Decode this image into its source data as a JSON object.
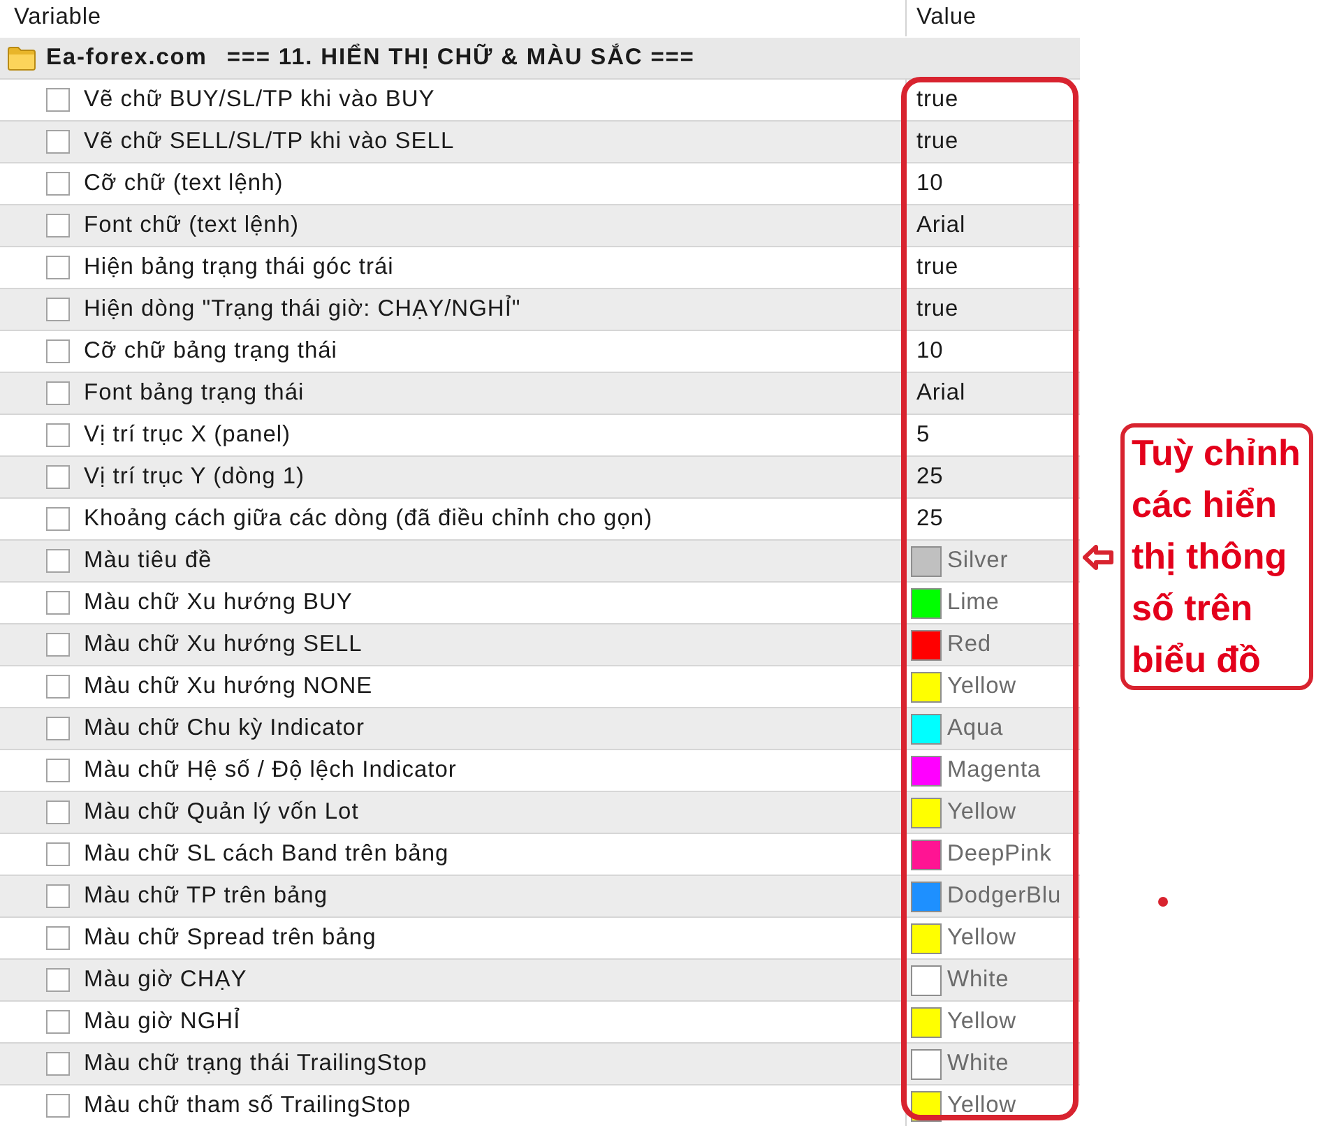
{
  "columns": [
    {
      "label": "Variable"
    },
    {
      "label": "Value"
    }
  ],
  "group": {
    "source": "Ea-forex.com",
    "title": "=== 11. HIỂN THỊ CHỮ & MÀU SẮC ==="
  },
  "rows": [
    {
      "name": "Vẽ chữ BUY/SL/TP khi vào BUY",
      "checked": false,
      "kind": "text",
      "value": "true"
    },
    {
      "name": "Vẽ chữ SELL/SL/TP khi vào SELL",
      "checked": false,
      "kind": "text",
      "value": "true"
    },
    {
      "name": "Cỡ chữ (text lệnh)",
      "checked": false,
      "kind": "text",
      "value": "10"
    },
    {
      "name": "Font chữ (text lệnh)",
      "checked": false,
      "kind": "text",
      "value": "Arial"
    },
    {
      "name": "Hiện bảng trạng thái góc trái",
      "checked": false,
      "kind": "text",
      "value": "true"
    },
    {
      "name": "Hiện dòng \"Trạng thái giờ: CHẠY/NGHỈ\"",
      "checked": false,
      "kind": "text",
      "value": "true"
    },
    {
      "name": "Cỡ chữ bảng trạng thái",
      "checked": false,
      "kind": "text",
      "value": "10"
    },
    {
      "name": "Font bảng trạng thái",
      "checked": false,
      "kind": "text",
      "value": "Arial"
    },
    {
      "name": "Vị trí trục X (panel)",
      "checked": false,
      "kind": "text",
      "value": "5"
    },
    {
      "name": "Vị trí trục Y (dòng 1)",
      "checked": false,
      "kind": "text",
      "value": "25"
    },
    {
      "name": "Khoảng cách giữa các dòng (đã điều chỉnh cho gọn)",
      "checked": false,
      "kind": "text",
      "value": "25"
    },
    {
      "name": "Màu tiêu đề",
      "checked": false,
      "kind": "color",
      "color": "#c0c0c0",
      "value": "Silver"
    },
    {
      "name": "Màu chữ Xu hướng BUY",
      "checked": false,
      "kind": "color",
      "color": "#00ff00",
      "value": "Lime"
    },
    {
      "name": "Màu chữ Xu hướng SELL",
      "checked": false,
      "kind": "color",
      "color": "#ff0000",
      "value": "Red"
    },
    {
      "name": "Màu chữ Xu hướng NONE",
      "checked": false,
      "kind": "color",
      "color": "#ffff00",
      "value": "Yellow"
    },
    {
      "name": "Màu chữ Chu kỳ Indicator",
      "checked": false,
      "kind": "color",
      "color": "#00ffff",
      "value": "Aqua"
    },
    {
      "name": "Màu chữ Hệ số / Độ lệch Indicator",
      "checked": false,
      "kind": "color",
      "color": "#ff00ff",
      "value": "Magenta"
    },
    {
      "name": "Màu chữ Quản lý vốn Lot",
      "checked": false,
      "kind": "color",
      "color": "#ffff00",
      "value": "Yellow"
    },
    {
      "name": "Màu chữ SL cách Band trên bảng",
      "checked": false,
      "kind": "color",
      "color": "#ff1493",
      "value": "DeepPink"
    },
    {
      "name": "Màu chữ TP trên bảng",
      "checked": false,
      "kind": "color",
      "color": "#1e90ff",
      "value": "DodgerBlu"
    },
    {
      "name": "Màu chữ Spread trên bảng",
      "checked": false,
      "kind": "color",
      "color": "#ffff00",
      "value": "Yellow"
    },
    {
      "name": "Màu giờ CHẠY",
      "checked": false,
      "kind": "color",
      "color": "#ffffff",
      "value": "White"
    },
    {
      "name": "Màu giờ NGHỈ",
      "checked": false,
      "kind": "color",
      "color": "#ffff00",
      "value": "Yellow"
    },
    {
      "name": "Màu chữ trạng thái TrailingStop",
      "checked": false,
      "kind": "color",
      "color": "#ffffff",
      "value": "White"
    },
    {
      "name": "Màu chữ tham số TrailingStop",
      "checked": false,
      "kind": "color",
      "color": "#ffff00",
      "value": "Yellow"
    }
  ],
  "annotation": {
    "text": "Tuỳ chỉnh các hiển thị thông số trên biểu đồ"
  }
}
